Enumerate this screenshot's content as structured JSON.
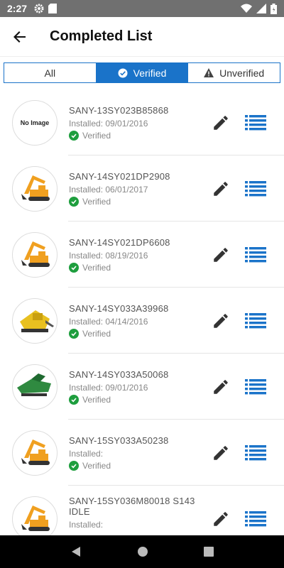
{
  "status_bar": {
    "time": "2:27",
    "icons_left": [
      "gear-icon",
      "sd-card-icon"
    ],
    "icons_right": [
      "wifi-icon",
      "signal-icon",
      "battery-icon"
    ]
  },
  "app_bar": {
    "back_icon": "arrow-back-icon",
    "title": "Completed List"
  },
  "tabs": [
    {
      "label": "All",
      "active": false,
      "icon": ""
    },
    {
      "label": "Verified",
      "active": true,
      "icon": "check-circle-icon"
    },
    {
      "label": "Unverified",
      "active": false,
      "icon": "warning-icon"
    }
  ],
  "no_image_text": "No Image",
  "items": [
    {
      "serial": "SANY-13SY023B85868",
      "installed": "Installed: 09/01/2016",
      "status": "Verified",
      "image": "none"
    },
    {
      "serial": "SANY-14SY021DP2908",
      "installed": "Installed: 06/01/2017",
      "status": "Verified",
      "image": "excavator"
    },
    {
      "serial": "SANY-14SY021DP6608",
      "installed": "Installed: 08/19/2016",
      "status": "Verified",
      "image": "excavator"
    },
    {
      "serial": "SANY-14SY033A39968",
      "installed": "Installed: 04/14/2016",
      "status": "Verified",
      "image": "crusher-yellow"
    },
    {
      "serial": "SANY-14SY033A50068",
      "installed": "Installed: 09/01/2016",
      "status": "Verified",
      "image": "screener-green"
    },
    {
      "serial": "SANY-15SY033A50238",
      "installed": "Installed:",
      "status": "Verified",
      "image": "excavator"
    },
    {
      "serial": "SANY-15SY036M80018 S143 IDLE",
      "installed": "Installed:",
      "status": "",
      "image": "excavator"
    }
  ],
  "colors": {
    "accent": "#1a73c9",
    "verified_green": "#1e9e3e",
    "status_bar": "#707070",
    "nav_bar": "#000000"
  }
}
